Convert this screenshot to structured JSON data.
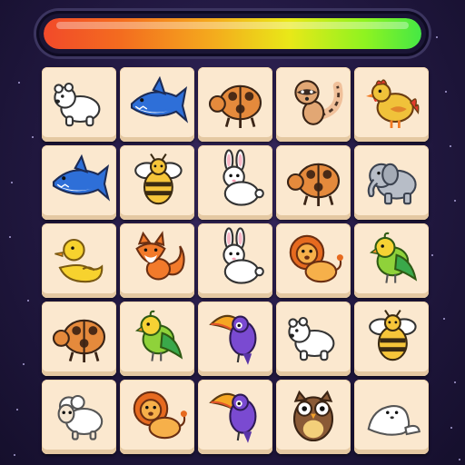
{
  "timer": {
    "fill_fraction": 1.0
  },
  "board": {
    "rows": 5,
    "cols": 5,
    "tiles": [
      [
        "polar-bear",
        "shark",
        "ladybug",
        "raccoon",
        "rooster"
      ],
      [
        "shark",
        "bee",
        "rabbit",
        "ladybug",
        "elephant"
      ],
      [
        "duck",
        "fox",
        "rabbit",
        "lion",
        "parakeet"
      ],
      [
        "ladybug",
        "parakeet",
        "toucan",
        "polar-bear",
        "bee"
      ],
      [
        "sheep",
        "lion",
        "toucan",
        "owl",
        "seal"
      ]
    ]
  },
  "colors": {
    "tile": "#fbe8cf",
    "tile_shadow": "#e4c8a2",
    "background": "#241a45"
  }
}
